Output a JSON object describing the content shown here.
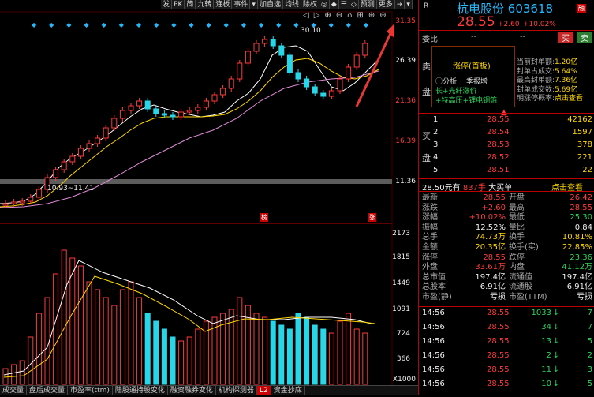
{
  "toolbar": {
    "items": [
      "发",
      "PK",
      "简",
      "九转",
      "连板",
      "事件",
      "▾",
      "加自选",
      "均线",
      "除权",
      "◎",
      "◆",
      "☰",
      "◇",
      "预测",
      "更多",
      "⇥",
      "▾"
    ]
  },
  "chart": {
    "price_axis": [
      "31.35",
      "26.39",
      "21.36",
      "16.39",
      "11.36"
    ],
    "vol_axis": [
      "2173",
      "1815",
      "1449",
      "1091",
      "724",
      "366",
      "X1000"
    ],
    "high_label": "30.10",
    "range_label": "10.93~11.41",
    "marker_left": "榜",
    "marker_right": "张"
  },
  "bottom_tabs": [
    "成交量",
    "盘后成交量",
    "市盈率(ttm)",
    "陆股通持股变化",
    "融资融券变化",
    "机构探测器",
    "L2",
    "资金抄底"
  ],
  "header": {
    "letter": "R",
    "name": "杭电股份",
    "code": "603618",
    "badge": "融",
    "price": "28.55",
    "change": "+2.60",
    "change_pct": "+10.02%",
    "weibi_label": "委比",
    "weibi_val1": "--",
    "weibi_val2": "--",
    "buy_btn": "买",
    "sell_btn": "卖"
  },
  "info": {
    "side_label_top": "卖",
    "side_label_bottom": "盘",
    "title": "涨停(首板)",
    "analysis_label": "分析:一季报增",
    "tags1": "长+光纤涨价",
    "tags2": "+特高压+锂电铜箔",
    "seal_amount_label": "当前封单额:",
    "seal_amount": "1.20亿",
    "seal_ratio_label": "封单占成交:",
    "seal_ratio": "5.64%",
    "max_seal_label": "最高封单额:",
    "max_seal": "7.36亿",
    "seal_turnover_label": "封单成交数:",
    "seal_turnover": "5.69亿",
    "prob_label": "明涨停概率:",
    "prob": "点击查看"
  },
  "bids": [
    {
      "n": "1",
      "price": "28.55",
      "vol": "42162"
    },
    {
      "n": "2",
      "price": "28.54",
      "vol": "1597"
    },
    {
      "n": "3",
      "price": "28.53",
      "vol": "378"
    },
    {
      "n": "4",
      "price": "28.52",
      "vol": "221"
    },
    {
      "n": "5",
      "price": "28.51",
      "vol": "22"
    }
  ],
  "bid_labels": {
    "top": "买",
    "bottom": "盘"
  },
  "big_order": {
    "price": "28.50元有",
    "hands": "837手",
    "label": "大买单",
    "link": "点击查看"
  },
  "quote": [
    {
      "l1": "最新",
      "v1": "28.55",
      "c1": "red",
      "l2": "开盘",
      "v2": "26.42",
      "c2": "red"
    },
    {
      "l1": "涨跌",
      "v1": "+2.60",
      "c1": "red",
      "l2": "最高",
      "v2": "28.55",
      "c2": "red"
    },
    {
      "l1": "涨幅",
      "v1": "+10.02%",
      "c1": "red",
      "l2": "最低",
      "v2": "25.30",
      "c2": "green"
    },
    {
      "l1": "振幅",
      "v1": "12.52%",
      "c1": "white",
      "l2": "量比",
      "v2": "0.84",
      "c2": "white"
    },
    {
      "l1": "总手",
      "v1": "74.73万",
      "c1": "yellow",
      "l2": "换手",
      "v2": "10.81%",
      "c2": "yellow"
    },
    {
      "l1": "金额",
      "v1": "20.35亿",
      "c1": "yellow",
      "l2": "换手(实)",
      "v2": "22.85%",
      "c2": "yellow"
    },
    {
      "l1": "涨停",
      "v1": "28.55",
      "c1": "red",
      "l2": "跌停",
      "v2": "23.36",
      "c2": "green"
    },
    {
      "l1": "外盘",
      "v1": "33.61万",
      "c1": "red",
      "l2": "内盘",
      "v2": "41.12万",
      "c2": "green"
    },
    {
      "l1": "总市值",
      "v1": "197.4亿",
      "c1": "white",
      "l2": "流通值",
      "v2": "197.4亿",
      "c2": "white"
    },
    {
      "l1": "总股本",
      "v1": "6.91亿",
      "c1": "white",
      "l2": "流通股",
      "v2": "6.91亿",
      "c2": "white"
    },
    {
      "l1": "市盈(静)",
      "v1": "亏损",
      "c1": "white",
      "l2": "市盈(TTM)",
      "v2": "亏损",
      "c2": "white"
    }
  ],
  "ticks": [
    {
      "t": "14:56",
      "p": "28.55",
      "v": "1033",
      "d": "↓",
      "n": "7"
    },
    {
      "t": "14:56",
      "p": "28.55",
      "v": "34",
      "d": "↓",
      "n": "7"
    },
    {
      "t": "14:56",
      "p": "28.55",
      "v": "13",
      "d": "↓",
      "n": "5"
    },
    {
      "t": "14:56",
      "p": "28.55",
      "v": "2",
      "d": "↓",
      "n": "2"
    },
    {
      "t": "14:56",
      "p": "28.55",
      "v": "11",
      "d": "↓",
      "n": "3"
    },
    {
      "t": "14:56",
      "p": "28.55",
      "v": "10",
      "d": "↓",
      "n": "5"
    }
  ]
}
